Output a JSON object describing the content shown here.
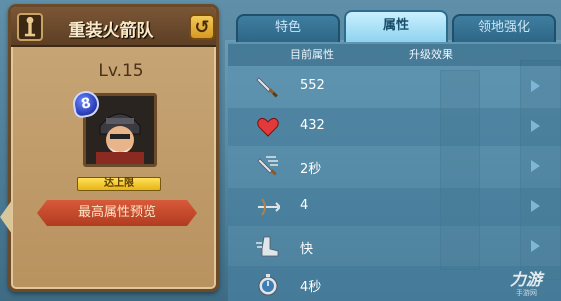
{
  "unit": {
    "name": "重装火箭队",
    "level": "Lv.15",
    "stars": "8",
    "max_level_label": "达上限",
    "preview_button": "最高属性预览"
  },
  "tabs": [
    {
      "label": "特色",
      "active": false
    },
    {
      "label": "属性",
      "active": true
    },
    {
      "label": "领地强化",
      "active": false
    }
  ],
  "table": {
    "col_current": "目前属性",
    "col_upgrade": "升级效果",
    "rows": [
      {
        "icon": "sword-icon",
        "value": "552"
      },
      {
        "icon": "heart-icon",
        "value": "432"
      },
      {
        "icon": "attack-speed-icon",
        "value": "2秒"
      },
      {
        "icon": "crossbow-range-icon",
        "value": "4"
      },
      {
        "icon": "boot-speed-icon",
        "value": "快"
      },
      {
        "icon": "stopwatch-icon",
        "value": "4秒"
      }
    ]
  },
  "watermark": {
    "main": "力游",
    "sub": "手游网"
  },
  "colors": {
    "card_bg": "#c9a778",
    "header_bg": "#5d3f24",
    "tab_active": "#8fd3ef",
    "panel_bg": "#4c7c96",
    "heart": "#e23a3a"
  }
}
